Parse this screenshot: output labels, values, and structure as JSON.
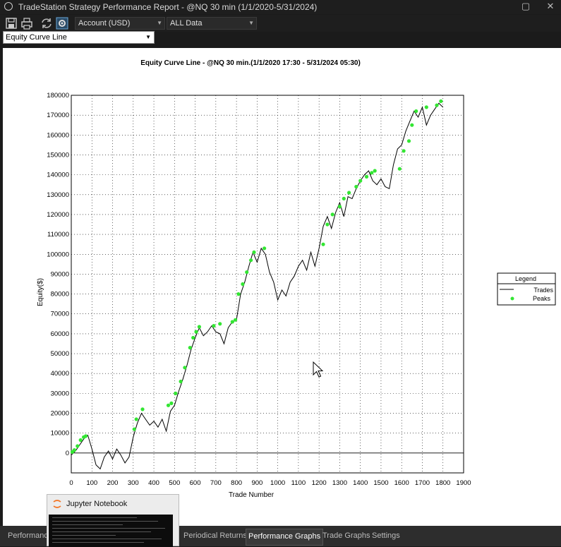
{
  "window": {
    "title": "TradeStation Strategy Performance Report - @NQ 30 min (1/1/2020-5/31/2024)"
  },
  "toolbar": {
    "icons": [
      "save-icon",
      "print-icon",
      "refresh-icon",
      "settings-icon"
    ],
    "account_select": "Account (USD)",
    "range_select": "ALL Data"
  },
  "graph_select": "Equity Curve Line",
  "chart_data": {
    "type": "line",
    "title": "Equity Curve Line - @NQ 30 min.(1/1/2020 17:30 - 5/31/2024 05:30)",
    "xlabel": "Trade Number",
    "ylabel": "Equity($)",
    "xlim": [
      0,
      1900
    ],
    "ylim": [
      -10000,
      180000
    ],
    "xticks": [
      0,
      100,
      200,
      300,
      400,
      500,
      600,
      700,
      800,
      900,
      1000,
      1100,
      1200,
      1300,
      1400,
      1500,
      1600,
      1700,
      1800,
      1900
    ],
    "yticks": [
      0,
      10000,
      20000,
      30000,
      40000,
      50000,
      60000,
      70000,
      80000,
      90000,
      100000,
      110000,
      120000,
      130000,
      140000,
      150000,
      160000,
      170000,
      180000
    ],
    "grid": true,
    "legend": {
      "title": "Legend",
      "position": "right",
      "entries": [
        "Trades",
        "Peaks"
      ]
    },
    "series": [
      {
        "name": "Trades",
        "color": "#000000",
        "x": [
          0,
          20,
          40,
          60,
          80,
          100,
          120,
          140,
          160,
          180,
          200,
          220,
          240,
          260,
          280,
          300,
          320,
          340,
          360,
          380,
          400,
          420,
          440,
          460,
          480,
          500,
          520,
          540,
          560,
          580,
          600,
          620,
          640,
          660,
          680,
          700,
          720,
          740,
          760,
          780,
          800,
          820,
          840,
          860,
          880,
          900,
          920,
          940,
          960,
          980,
          1000,
          1020,
          1040,
          1060,
          1080,
          1100,
          1120,
          1140,
          1160,
          1180,
          1200,
          1220,
          1240,
          1260,
          1280,
          1300,
          1320,
          1340,
          1360,
          1380,
          1400,
          1420,
          1440,
          1460,
          1480,
          1500,
          1520,
          1540,
          1560,
          1580,
          1600,
          1620,
          1640,
          1660,
          1680,
          1700,
          1720,
          1740,
          1760,
          1780,
          1800
        ],
        "y": [
          -1000,
          1000,
          4000,
          7000,
          9000,
          2000,
          -6000,
          -8000,
          -2000,
          1000,
          -3000,
          2000,
          -1000,
          -5000,
          -2000,
          8000,
          15000,
          20000,
          17000,
          14000,
          16000,
          13000,
          17000,
          11000,
          21000,
          24000,
          31000,
          37000,
          44000,
          52000,
          58000,
          63000,
          59000,
          61000,
          64000,
          61000,
          60000,
          55000,
          63000,
          66000,
          67000,
          80000,
          86000,
          94000,
          101000,
          96000,
          103000,
          100000,
          91000,
          86000,
          77000,
          82000,
          79000,
          86000,
          89000,
          94000,
          97000,
          92000,
          101000,
          94000,
          103000,
          114000,
          119000,
          113000,
          121000,
          126000,
          119000,
          129000,
          128000,
          133000,
          137000,
          140000,
          142000,
          137000,
          135000,
          138000,
          134000,
          133000,
          145000,
          153000,
          155000,
          162000,
          167000,
          172000,
          169000,
          174000,
          165000,
          170000,
          173000,
          176000,
          174000
        ]
      },
      {
        "name": "Peaks",
        "color": "#33e633",
        "x": [
          5,
          15,
          30,
          45,
          60,
          70,
          305,
          315,
          345,
          470,
          485,
          505,
          530,
          550,
          575,
          590,
          605,
          620,
          690,
          720,
          780,
          795,
          810,
          830,
          850,
          870,
          885,
          935,
          1220,
          1240,
          1265,
          1300,
          1320,
          1345,
          1380,
          1400,
          1430,
          1455,
          1470,
          1590,
          1610,
          1635,
          1650,
          1670,
          1720,
          1770,
          1790
        ],
        "y": [
          500,
          1500,
          3500,
          6500,
          8000,
          8500,
          12000,
          17000,
          22000,
          24000,
          25000,
          30000,
          36000,
          43000,
          53000,
          58000,
          61000,
          63500,
          64000,
          65000,
          66000,
          67000,
          80000,
          85000,
          91000,
          97000,
          101000,
          103000,
          105000,
          115000,
          120000,
          124000,
          128000,
          131000,
          134000,
          137000,
          139000,
          141000,
          142000,
          143000,
          152000,
          157000,
          165000,
          172000,
          174000,
          175000,
          177000
        ]
      }
    ]
  },
  "tabs": [
    "Performance",
    "Periodical Returns",
    "Performance Graphs",
    "Trade Graphs",
    "Settings"
  ],
  "active_tab": "Performance Graphs",
  "taskbar_preview": {
    "title": "Jupyter Notebook"
  }
}
